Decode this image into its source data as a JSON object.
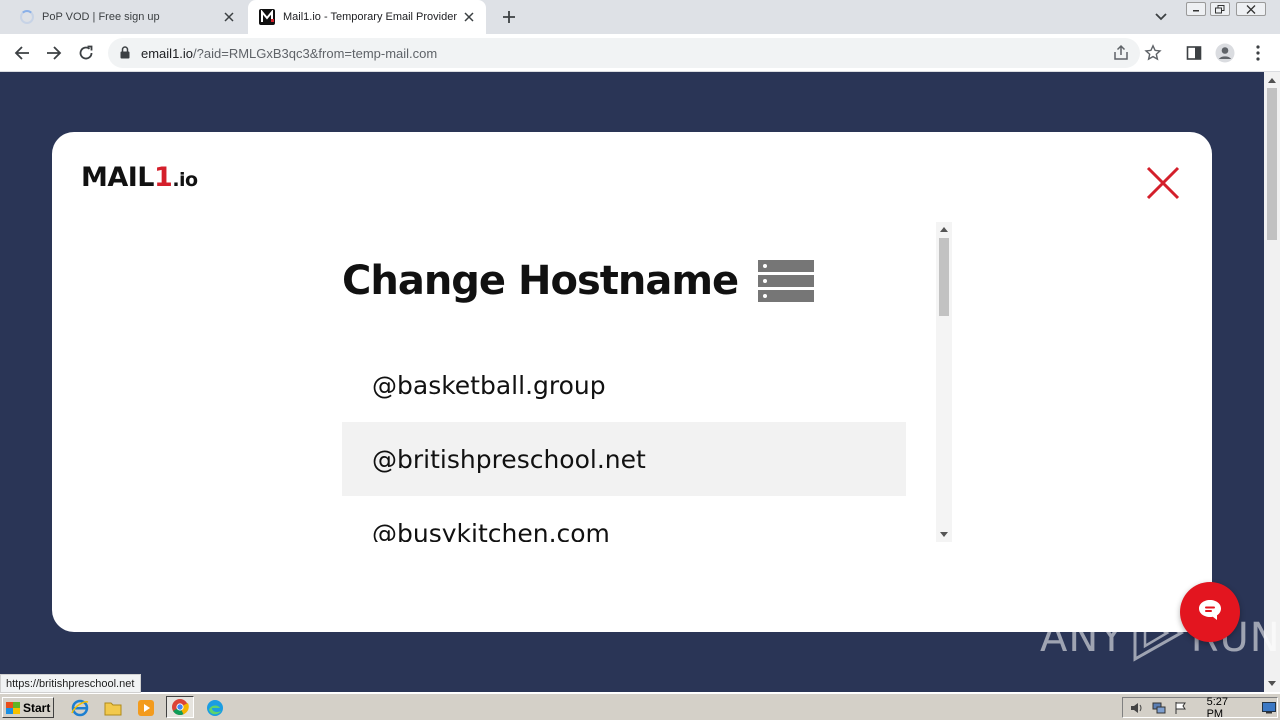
{
  "browser": {
    "tabs": [
      {
        "title": "PoP VOD | Free sign up",
        "active": false
      },
      {
        "title": "Mail1.io - Temporary Email Provider",
        "active": true
      }
    ],
    "url_host": "email1.io",
    "url_rest": "/?aid=RMLGxB3qc3&from=temp-mail.com",
    "status_url": "https://britishpreschool.net"
  },
  "page": {
    "logo_main": "MAIL",
    "logo_num": "1",
    "logo_suffix": ".io",
    "heading": "Change Hostname",
    "hostnames": [
      "@basketball.group",
      "@britishpreschool.net",
      "@busykitchen.com"
    ],
    "hovered_index": 1,
    "watermark_left": "ANY",
    "watermark_right": "RUN"
  },
  "taskbar": {
    "start_label": "Start",
    "clock": "5:27 PM"
  },
  "colors": {
    "page_bg": "#2a3556",
    "accent_red": "#d41f2b",
    "chat_red": "#e3151f"
  }
}
